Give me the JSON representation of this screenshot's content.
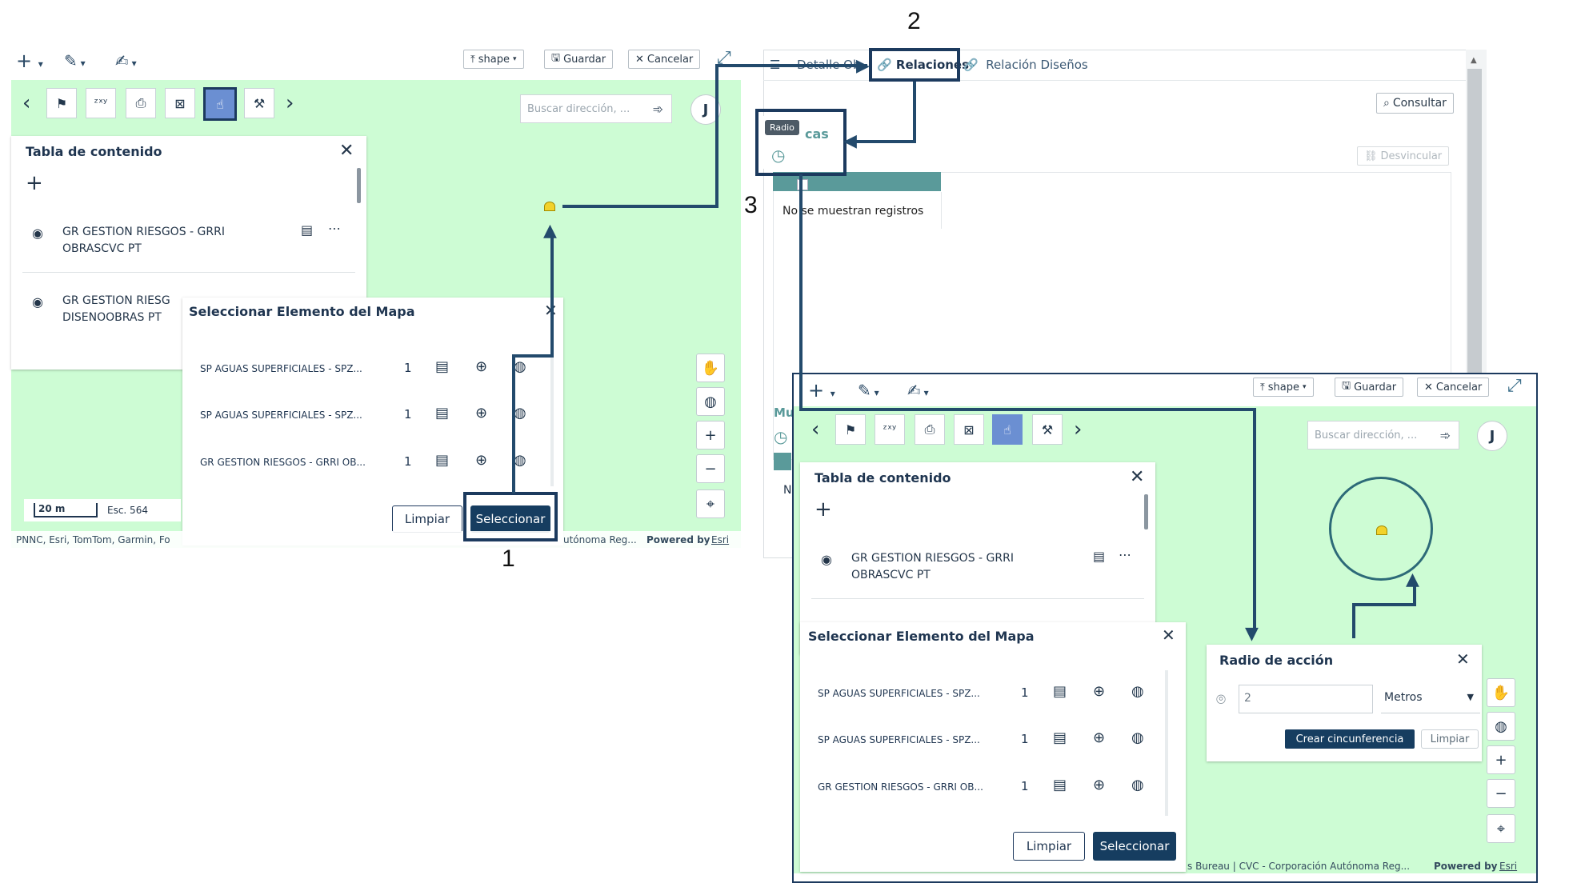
{
  "left": {
    "toolbar": {
      "add": "+",
      "draw": "✎",
      "edit": "✍",
      "upload_label": "shape",
      "save_label": "Guardar",
      "cancel_label": "Cancelar"
    },
    "search_placeholder": "Buscar dirección, ...",
    "user_initial": "J",
    "toc": {
      "title": "Tabla de contenido",
      "items": [
        {
          "line1": "GR GESTION RIESGOS - GRRI",
          "line2": "OBRASCVC PT"
        },
        {
          "line1": "GR GESTION RIESG",
          "line2": "DISENOOBRAS PT"
        }
      ]
    },
    "select_panel": {
      "title": "Seleccionar Elemento del Mapa",
      "rows": [
        {
          "name": "SP AGUAS SUPERFICIALES - SPZ...",
          "count": "1"
        },
        {
          "name": "SP AGUAS SUPERFICIALES - SPZ...",
          "count": "1"
        },
        {
          "name": "GR GESTION RIESGOS - GRRI OB...",
          "count": "1"
        }
      ],
      "clear_label": "Limpiar",
      "select_label": "Seleccionar"
    },
    "scale": {
      "bar": "20 m",
      "text": "Esc. 564"
    },
    "attribution": "PNNC, Esri, TomTom, Garmin, Fo",
    "attribution_right": "utónoma Reg...",
    "powered": "Powered by",
    "esri": "Esri"
  },
  "middle": {
    "tabs": [
      {
        "label": "Detalle Ob"
      },
      {
        "label": "Relaciones"
      },
      {
        "label": "Relación Diseños"
      }
    ],
    "consult_label": "Consultar",
    "unlink_label": "Desvincular",
    "tooltip": "Radio",
    "section_title": "cas",
    "empty_text": "No se muestran registros",
    "section_title2": "Mu",
    "n_text": "N"
  },
  "right": {
    "toolbar": {
      "upload_label": "shape",
      "save_label": "Guardar",
      "cancel_label": "Cancelar"
    },
    "search_placeholder": "Buscar dirección, ...",
    "user_initial": "J",
    "toc": {
      "title": "Tabla de contenido",
      "items": [
        {
          "line1": "GR GESTION RIESGOS - GRRI",
          "line2": "OBRASCVC PT"
        }
      ]
    },
    "select_panel": {
      "title": "Seleccionar Elemento del Mapa",
      "rows": [
        {
          "name": "SP AGUAS SUPERFICIALES - SPZ...",
          "count": "1"
        },
        {
          "name": "SP AGUAS SUPERFICIALES - SPZ...",
          "count": "1"
        },
        {
          "name": "GR GESTION RIESGOS - GRRI OB...",
          "count": "1"
        }
      ],
      "clear_label": "Limpiar",
      "select_label": "Seleccionar"
    },
    "radius_panel": {
      "title": "Radio de acción",
      "value": "2",
      "unit": "Metros",
      "create_label": "Crear cincunferencia",
      "clear_label": "Limpiar"
    },
    "attribution": "s Bureau | CVC - Corporación Autónoma Reg...",
    "powered": "Powered by",
    "esri": "Esri"
  },
  "callouts": {
    "one": "1",
    "two": "2",
    "three": "3"
  },
  "colors": {
    "map": "#cdfcd4",
    "dark": "#163d60",
    "accent": "#5a9a9a"
  }
}
